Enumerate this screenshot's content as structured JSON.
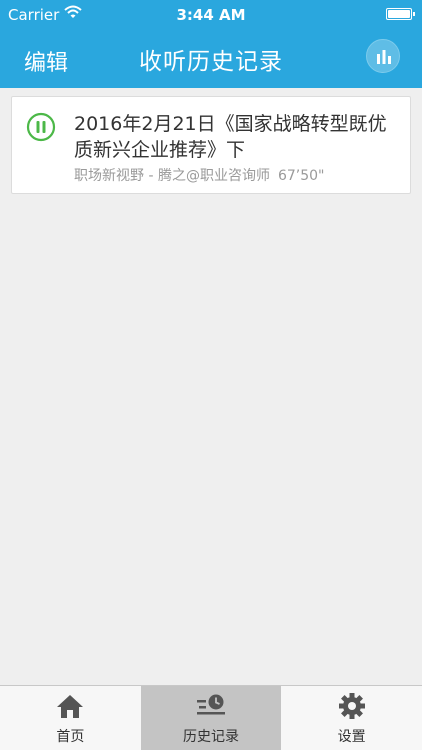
{
  "status_bar": {
    "carrier": "Carrier",
    "time": "3:44 AM"
  },
  "nav": {
    "edit_label": "编辑",
    "title": "收听历史记录"
  },
  "history": [
    {
      "title": "2016年2月21日《国家战略转型既优质新兴企业推荐》下",
      "meta": "职场新视野 - 腾之@职业咨询师",
      "duration": "67’50\"",
      "state": "playing"
    }
  ],
  "tabs": [
    {
      "label": "首页",
      "icon": "home-icon",
      "active": false
    },
    {
      "label": "历史记录",
      "icon": "history-icon",
      "active": true
    },
    {
      "label": "设置",
      "icon": "gear-icon",
      "active": false
    }
  ],
  "colors": {
    "header": "#2aa7de",
    "accent_green": "#4cb848",
    "background": "#efefef"
  }
}
